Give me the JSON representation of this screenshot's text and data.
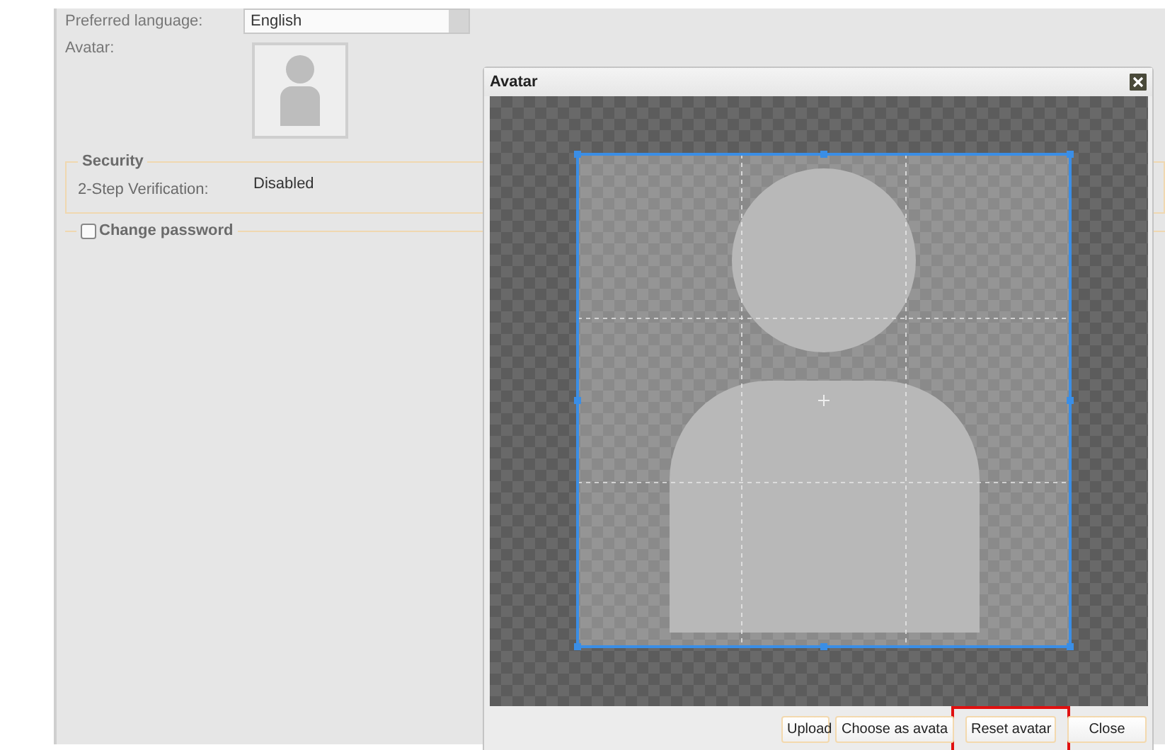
{
  "form": {
    "fields": [
      {
        "label": "Preferred language:",
        "value": "English"
      }
    ],
    "avatar_label": "Avatar:",
    "security": {
      "legend": "Security",
      "rows": [
        {
          "label": "2-Step Verification:",
          "value": "Disabled"
        }
      ]
    },
    "change_password": {
      "label": "Change password",
      "checked": false
    }
  },
  "dialog": {
    "title": "Avatar",
    "buttons": [
      {
        "label": "Upload",
        "highlighted": false
      },
      {
        "label": "Choose as avata",
        "highlighted": false
      },
      {
        "label": "Reset avatar",
        "highlighted": true
      },
      {
        "label": "Close",
        "highlighted": false
      }
    ]
  }
}
